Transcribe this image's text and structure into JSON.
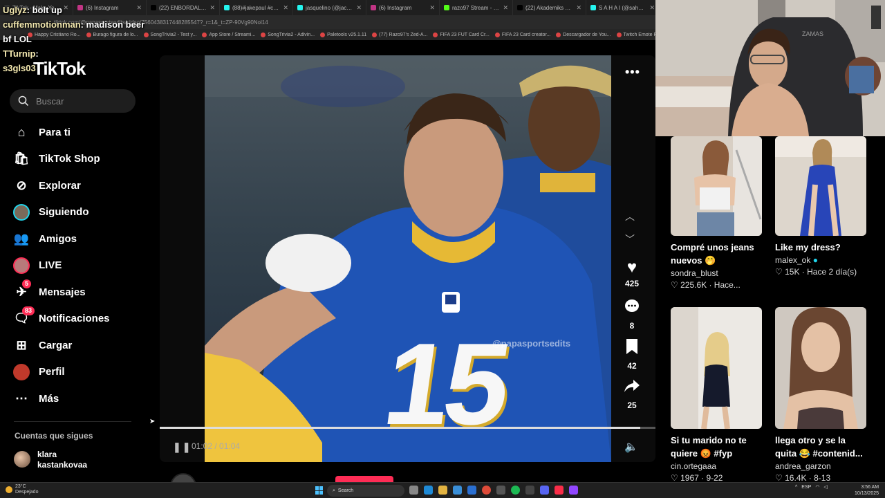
{
  "browser": {
    "tabs": [
      {
        "label": "TikTok - Make Your Day",
        "color": "#333333"
      },
      {
        "label": "(6) Instagram",
        "color": "#c13584"
      },
      {
        "label": "(22) ENBORDALAO es on",
        "color": "#000000"
      },
      {
        "label": "(88)#jakepaul #chaka | Ja",
        "color": "#25f4ee"
      },
      {
        "label": "jasquelino (@jacqueelgr)",
        "color": "#25f4ee"
      },
      {
        "label": "(6) Instagram",
        "color": "#c13584"
      },
      {
        "label": "razo97 Stream - Watch Li",
        "color": "#53fc18"
      },
      {
        "label": "(22) Akademiks TV on X",
        "color": "#000000"
      },
      {
        "label": "S A H A I (@sahai_) | TikT",
        "color": "#25f4ee"
      }
    ],
    "url": "tiktok.com/@papasportsedits/video/7560438317448285547?_r=1&_t=ZP-90Vg90Nol14",
    "bookmarks": [
      "Happy Cristiano Ro...",
      "Burago figura de lo...",
      "SongTrivia2 - Test y...",
      "App Store / Streami...",
      "SongTrivia2 - Adivin...",
      "Paletools v25.1.11",
      "(77) Razo97's Zed-A...",
      "FIFA 23 FUT Card Cr...",
      "FIFA 23 Card creator...",
      "Descargador de You...",
      "Twitch Emote Resizer",
      "twitch emote resizer..."
    ]
  },
  "chat": [
    {
      "user": "Uglyz",
      "text": ": bolt up"
    },
    {
      "user": "cuffemmotionman",
      "text": ": madison beer"
    },
    {
      "user": "",
      "text": "bf LOL"
    },
    {
      "user": "TTurnip",
      "text": ":"
    },
    {
      "user": "s3gls03",
      "text": ""
    }
  ],
  "tiktok": {
    "logo": "TikTok",
    "search_placeholder": "Buscar",
    "nav": [
      {
        "label": "Para ti",
        "icon": "home-icon",
        "glyph": "⌂"
      },
      {
        "label": "TikTok Shop",
        "icon": "shop-icon",
        "glyph": "🛍"
      },
      {
        "label": "Explorar",
        "icon": "compass-icon",
        "glyph": "⊘"
      },
      {
        "label": "Siguiendo",
        "icon": "following-avatar-icon",
        "glyph": ""
      },
      {
        "label": "Amigos",
        "icon": "friends-icon",
        "glyph": "👥"
      },
      {
        "label": "LIVE",
        "icon": "live-avatar-icon",
        "glyph": ""
      },
      {
        "label": "Mensajes",
        "icon": "messages-icon",
        "glyph": "✈",
        "badge": "5"
      },
      {
        "label": "Notificaciones",
        "icon": "notifications-icon",
        "glyph": "🗨",
        "badge": "83"
      },
      {
        "label": "Cargar",
        "icon": "upload-icon",
        "glyph": "⊞"
      },
      {
        "label": "Perfil",
        "icon": "profile-avatar-icon",
        "glyph": ""
      },
      {
        "label": "Más",
        "icon": "more-icon",
        "glyph": "⋯"
      }
    ],
    "following_title": "Cuentas que sigues",
    "following": [
      {
        "name_line1": "klara",
        "name_line2": "kastankovaa"
      }
    ],
    "video": {
      "watermark": "@papasportsedits",
      "jersey_number": "15",
      "likes": "425",
      "comments": "8",
      "saves": "42",
      "shares": "25",
      "time": "01:02 / 01:04",
      "progress": 0.97,
      "author": "papasportsedits"
    },
    "feed": [
      {
        "title_line1": "Compré unos jeans",
        "title_line2": "nuevos 🤭",
        "author": "sondra_blust",
        "meta": "♡ 225.6K · Hace...",
        "verified": false
      },
      {
        "title_line1": "Like my dress?",
        "title_line2": "",
        "author": "malex_ok",
        "meta": "♡ 15K · Hace 2 día(s)",
        "verified": true
      },
      {
        "title_line1": "Si tu marido no te",
        "title_line2": "quiere 😡 #fyp",
        "author": "cin.ortegaaa",
        "meta": "♡ 1967 · 9-22",
        "verified": false
      },
      {
        "title_line1": "llega otro y se la",
        "title_line2": "quita 😂 #contenid...",
        "author": "andrea_garzon",
        "meta": "♡ 16.4K · 8-13",
        "verified": false
      }
    ]
  },
  "taskbar": {
    "weather_temp": "23°C",
    "weather_desc": "Despejado",
    "search_label": "Search",
    "lang": "ESP",
    "time": "3:56 AM",
    "date": "10/13/2025"
  }
}
